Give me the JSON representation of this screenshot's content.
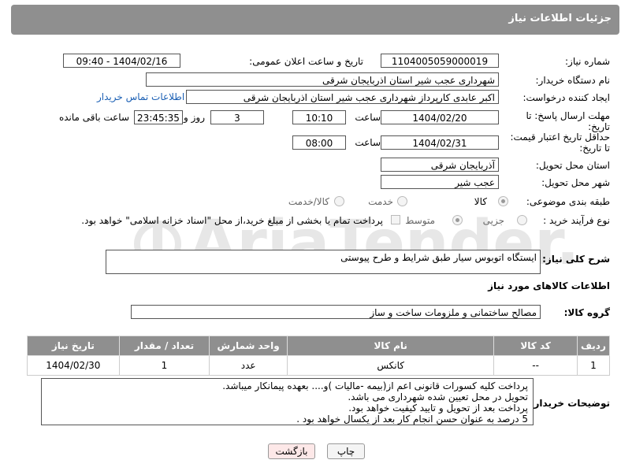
{
  "header": {
    "title": "جزئیات اطلاعات نیاز"
  },
  "form": {
    "need_number_label": "شماره نیاز:",
    "need_number": "1104005059000019",
    "announce_label": "تاریخ و ساعت اعلان عمومی:",
    "announce_value": "1404/02/16 - 09:40",
    "buyer_label": "نام دستگاه خریدار:",
    "buyer_value": "شهرداری عجب شیر استان اذربایجان شرقی",
    "creator_label": "ایجاد کننده درخواست:",
    "creator_value": "اکبر عابدی کارپرداز شهرداری عجب شیر استان اذربایجان شرقی",
    "contact_link": "اطلاعات تماس خریدار",
    "deadline_label_1": "مهلت ارسال پاسخ: تا",
    "deadline_label_2": "تاریخ:",
    "deadline_date": "1404/02/20",
    "hour_label": "ساعت",
    "deadline_time": "10:10",
    "days_value": "3",
    "days_label": "روز و",
    "remaining_value": "23:45:35",
    "remaining_label": "ساعت باقی مانده",
    "validity_label_1": "حداقل تاریخ اعتبار قیمت:",
    "validity_label_2": "تا تاریخ:",
    "validity_date": "1404/02/31",
    "validity_time": "08:00",
    "province_label": "استان محل تحویل:",
    "province_value": "آذربایجان شرقی",
    "city_label": "شهر محل تحویل:",
    "city_value": "عجب شیر",
    "category_label": "طبقه بندی موضوعی:",
    "category_options": [
      "کالا",
      "خدمت",
      "کالا/خدمت"
    ],
    "process_label": "نوع فرآیند خرید :",
    "process_options": [
      "جزیی",
      "متوسط"
    ],
    "payment_note": "پرداخت تمام یا بخشی از مبلغ خرید،از محل \"اسناد خزانه اسلامی\" خواهد بود.",
    "description_label": "شرح کلی نیاز:",
    "description_value": "ایستگاه اتوبوس سیار طبق شرایط و طرح پیوستی"
  },
  "goods": {
    "section_title": "اطلاعات کالاهای مورد نیاز",
    "group_label": "گروه کالا:",
    "group_value": "مصالح ساختمانی و ملزومات ساخت و ساز",
    "columns": [
      "ردیف",
      "کد کالا",
      "نام کالا",
      "واحد شمارش",
      "تعداد / مقدار",
      "تاریخ نیاز"
    ],
    "rows": [
      {
        "row": "1",
        "code": "--",
        "name": "کانکس",
        "unit": "عدد",
        "qty": "1",
        "date": "1404/02/30"
      }
    ]
  },
  "notes": {
    "label": "توضیحات خریدار:",
    "lines": [
      "پرداخت کلیه کسورات قانونی اعم از(بیمه -مالیات )و.... بعهده پیمانکار میباشد.",
      "تحویل در محل تعیین شده شهرداری می باشد.",
      "پرداخت بعد از تحویل  و تایید کیفیت خواهد بود.",
      "5 درصد به عنوان حسن انجام کار بعد از یکسال خواهد بود ."
    ]
  },
  "buttons": {
    "print": "چاپ",
    "back": "بازگشت"
  },
  "watermark": {
    "text": "AriaTender.neT",
    "color": "#000000"
  },
  "colors": {
    "header_bg": "#8f8f8f",
    "link": "#1a5fb4",
    "back_button_bg": "#fde8e8"
  }
}
